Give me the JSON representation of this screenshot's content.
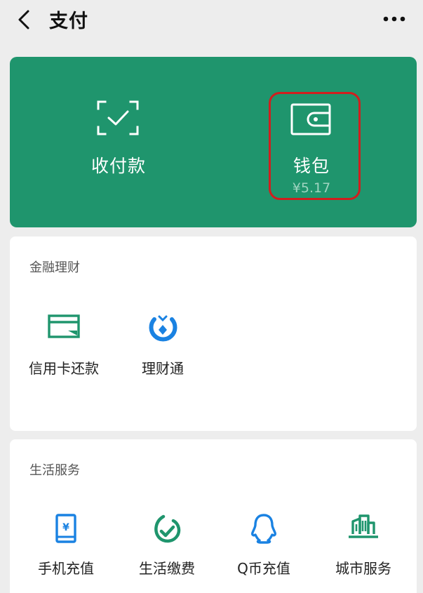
{
  "header": {
    "title": "支付",
    "back_icon": "chevron-left-icon",
    "more_icon": "more-dots-icon"
  },
  "pay_card": {
    "background": "#1f956d",
    "receive": {
      "label": "收付款",
      "icon": "scan-check-icon"
    },
    "wallet": {
      "label": "钱包",
      "balance": "¥5.17",
      "icon": "wallet-icon"
    },
    "highlight_color": "#d11e1e"
  },
  "finance": {
    "title": "金融理财",
    "items": [
      {
        "label": "信用卡还款",
        "icon": "credit-card-icon"
      },
      {
        "label": "理财通",
        "icon": "wealth-icon"
      }
    ]
  },
  "life": {
    "title": "生活服务",
    "items": [
      {
        "label": "手机充值",
        "icon": "phone-recharge-icon"
      },
      {
        "label": "生活缴费",
        "icon": "utility-bill-icon"
      },
      {
        "label": "Q币充值",
        "icon": "qq-coin-icon"
      },
      {
        "label": "城市服务",
        "icon": "city-service-icon"
      }
    ]
  },
  "colors": {
    "accent_green": "#1f956d",
    "icon_blue": "#1a82e2"
  }
}
